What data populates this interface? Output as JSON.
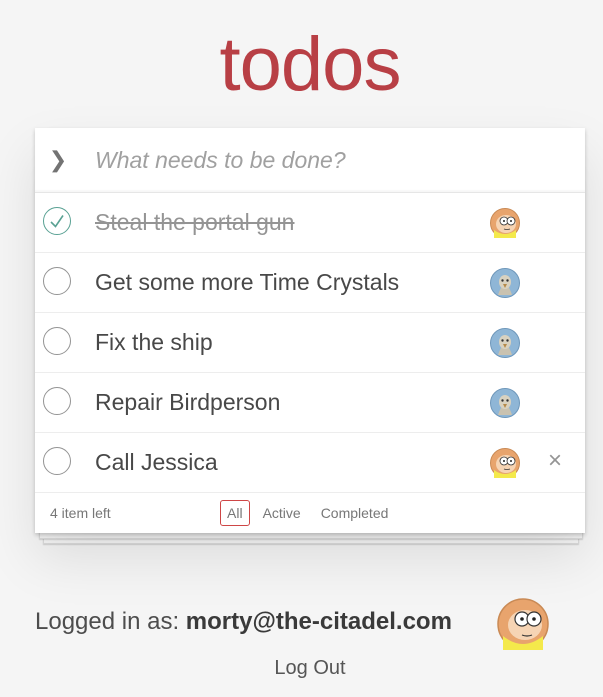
{
  "app": {
    "title": "todos"
  },
  "new_todo": {
    "placeholder": "What needs to be done?",
    "value": ""
  },
  "todos": [
    {
      "label": "Steal the portal gun",
      "completed": true,
      "avatar": "morty"
    },
    {
      "label": "Get some more Time Crystals",
      "completed": false,
      "avatar": "birdperson"
    },
    {
      "label": "Fix the ship",
      "completed": false,
      "avatar": "birdperson"
    },
    {
      "label": "Repair Birdperson",
      "completed": false,
      "avatar": "birdperson"
    },
    {
      "label": "Call Jessica",
      "completed": false,
      "avatar": "morty",
      "hovered": true
    }
  ],
  "footer": {
    "count_text": "4 item left",
    "filters": [
      "All",
      "Active",
      "Completed"
    ],
    "selected_filter": "All"
  },
  "user": {
    "logged_in_prefix": "Logged in as: ",
    "email": "morty@the-citadel.com",
    "logout_label": "Log Out"
  },
  "icons": {
    "toggle_all": "chevron-down-icon",
    "check": "checkmark-icon",
    "destroy": "close-icon"
  },
  "colors": {
    "brand": "#b83f45",
    "check_done": "#59a193",
    "filter_selected": "#ce4646",
    "background": "#f5f5f5"
  }
}
